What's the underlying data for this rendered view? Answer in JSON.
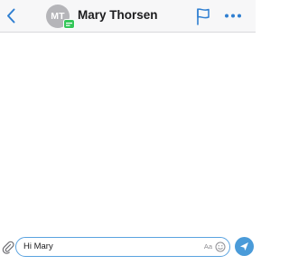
{
  "header": {
    "avatar_initials": "MT",
    "contact_name": "Mary Thorsen",
    "icons": {
      "back": "chevron-left-icon",
      "badge": "message-badge-icon",
      "flag": "flag-icon",
      "more": "more-horizontal-icon"
    }
  },
  "composer": {
    "input_value": "Hi Mary",
    "format_label": "Aa",
    "icons": {
      "attach": "paperclip-icon",
      "emoji": "emoji-icon",
      "send": "send-icon"
    }
  },
  "colors": {
    "accent": "#2f7fd1",
    "avatar_bg": "#b5b5b9",
    "badge_green": "#34c759",
    "send_bg": "#4a9bd9",
    "input_border": "#5aa3e0",
    "header_bg": "#f7f7f8"
  }
}
